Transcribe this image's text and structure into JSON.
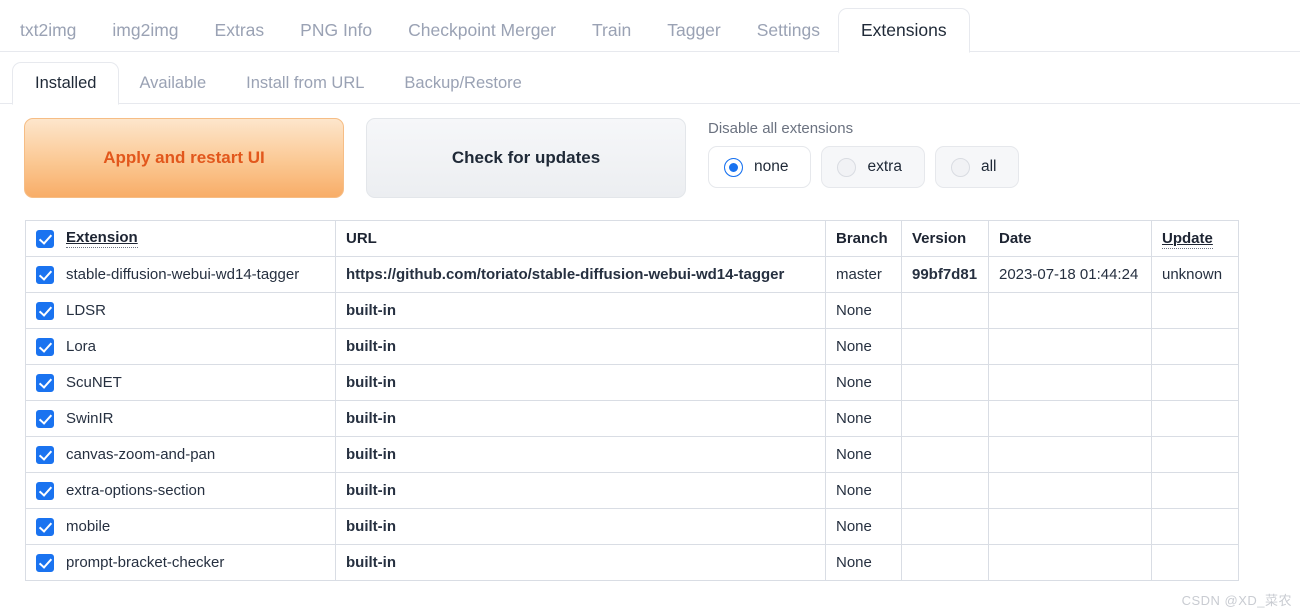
{
  "top_tabs": [
    {
      "label": "txt2img",
      "active": false
    },
    {
      "label": "img2img",
      "active": false
    },
    {
      "label": "Extras",
      "active": false
    },
    {
      "label": "PNG Info",
      "active": false
    },
    {
      "label": "Checkpoint Merger",
      "active": false
    },
    {
      "label": "Train",
      "active": false
    },
    {
      "label": "Tagger",
      "active": false
    },
    {
      "label": "Settings",
      "active": false
    },
    {
      "label": "Extensions",
      "active": true
    }
  ],
  "sub_tabs": [
    {
      "label": "Installed",
      "active": true
    },
    {
      "label": "Available",
      "active": false
    },
    {
      "label": "Install from URL",
      "active": false
    },
    {
      "label": "Backup/Restore",
      "active": false
    }
  ],
  "controls": {
    "apply_button": "Apply and restart UI",
    "check_button": "Check for updates",
    "disable_label": "Disable all extensions",
    "radios": [
      {
        "label": "none",
        "selected": true
      },
      {
        "label": "extra",
        "selected": false
      },
      {
        "label": "all",
        "selected": false
      }
    ]
  },
  "table": {
    "headers": [
      "Extension",
      "URL",
      "Branch",
      "Version",
      "Date",
      "Update"
    ],
    "rows": [
      {
        "checked": true,
        "extension": "stable-diffusion-webui-wd14-tagger",
        "url": "https://github.com/toriato/stable-diffusion-webui-wd14-tagger",
        "branch": "master",
        "version": "99bf7d81",
        "date": "2023-07-18 01:44:24",
        "update": "unknown"
      },
      {
        "checked": true,
        "extension": "LDSR",
        "url": "built-in",
        "branch": "None",
        "version": "",
        "date": "",
        "update": ""
      },
      {
        "checked": true,
        "extension": "Lora",
        "url": "built-in",
        "branch": "None",
        "version": "",
        "date": "",
        "update": ""
      },
      {
        "checked": true,
        "extension": "ScuNET",
        "url": "built-in",
        "branch": "None",
        "version": "",
        "date": "",
        "update": ""
      },
      {
        "checked": true,
        "extension": "SwinIR",
        "url": "built-in",
        "branch": "None",
        "version": "",
        "date": "",
        "update": ""
      },
      {
        "checked": true,
        "extension": "canvas-zoom-and-pan",
        "url": "built-in",
        "branch": "None",
        "version": "",
        "date": "",
        "update": ""
      },
      {
        "checked": true,
        "extension": "extra-options-section",
        "url": "built-in",
        "branch": "None",
        "version": "",
        "date": "",
        "update": ""
      },
      {
        "checked": true,
        "extension": "mobile",
        "url": "built-in",
        "branch": "None",
        "version": "",
        "date": "",
        "update": ""
      },
      {
        "checked": true,
        "extension": "prompt-bracket-checker",
        "url": "built-in",
        "branch": "None",
        "version": "",
        "date": "",
        "update": ""
      }
    ]
  },
  "watermark": "CSDN @XD_菜农",
  "colors": {
    "accent_blue": "#1a73f0",
    "apply_text": "#e2571c",
    "apply_gradient_top": "#fde6cc",
    "apply_gradient_bottom": "#f8ad68",
    "tab_inactive_text": "#9aa2b4",
    "border": "#d9dde4"
  }
}
